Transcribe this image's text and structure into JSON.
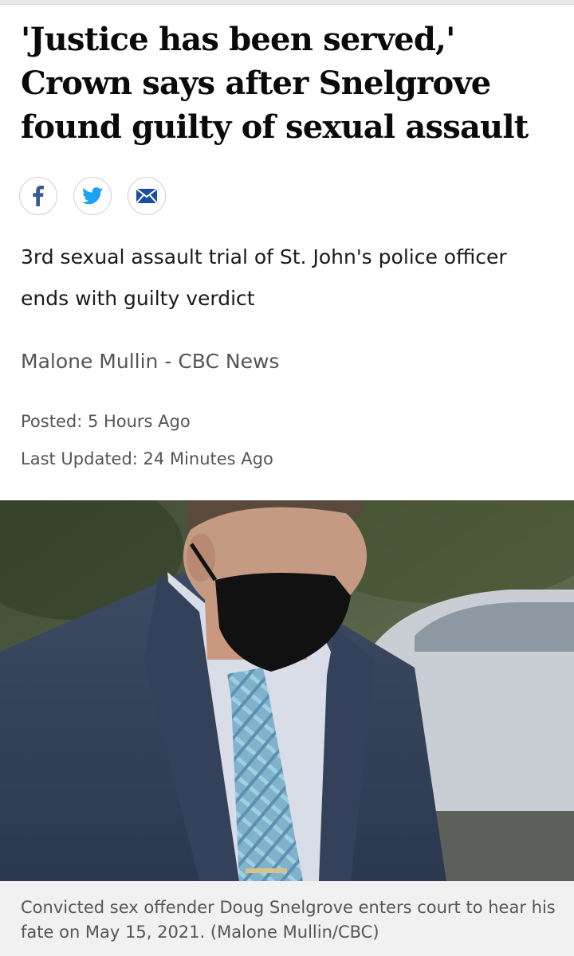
{
  "article": {
    "headline": "'Justice has been served,' Crown says after Snelgrove found guilty of sexual assault",
    "deck": "3rd sexual assault trial of St. John's police officer ends with guilty verdict",
    "byline": "Malone Mullin - CBC News",
    "posted": "Posted: 5 Hours Ago",
    "updated": "Last Updated: 24 Minutes Ago"
  },
  "share": [
    {
      "icon": "facebook-icon",
      "color": "#3b5998"
    },
    {
      "icon": "twitter-icon",
      "color": "#1da1f2"
    },
    {
      "icon": "email-icon",
      "color": "#1a4fa0"
    }
  ],
  "photo": {
    "caption": "Convicted sex offender Doug Snelgrove enters court to hear his fate on May 15, 2021. (Malone Mullin/CBC)"
  }
}
